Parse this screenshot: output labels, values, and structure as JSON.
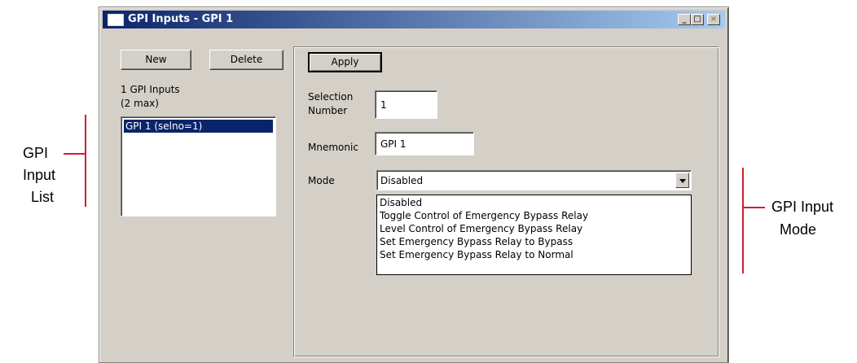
{
  "callouts": {
    "left": [
      "GPI",
      "Input",
      "List"
    ],
    "right": [
      "GPI Input",
      "Mode"
    ]
  },
  "window": {
    "title": "GPI Inputs - GPI 1",
    "minimize_glyph": "_",
    "maximize_glyph": "□",
    "close_glyph": "×"
  },
  "left_panel": {
    "new_label": "New",
    "delete_label": "Delete",
    "count_line1": "1 GPI Inputs",
    "count_line2": "(2 max)",
    "items": [
      "GPI 1 (selno=1)"
    ]
  },
  "right_panel": {
    "apply_label": "Apply",
    "selection_label_line1": "Selection",
    "selection_label_line2": "Number",
    "selection_value": "1",
    "mnemonic_label": "Mnemonic",
    "mnemonic_value": "GPI 1",
    "mode_label": "Mode",
    "mode_value": "Disabled",
    "mode_options": [
      "Disabled",
      "Toggle Control of Emergency Bypass Relay",
      "Level Control of Emergency Bypass Relay",
      "Set Emergency Bypass Relay to Bypass",
      "Set Emergency Bypass Relay to Normal"
    ]
  },
  "colors": {
    "callout_line": "#d0202e",
    "selection_highlight": "#0a246a",
    "window_face": "#d4d0c8"
  }
}
